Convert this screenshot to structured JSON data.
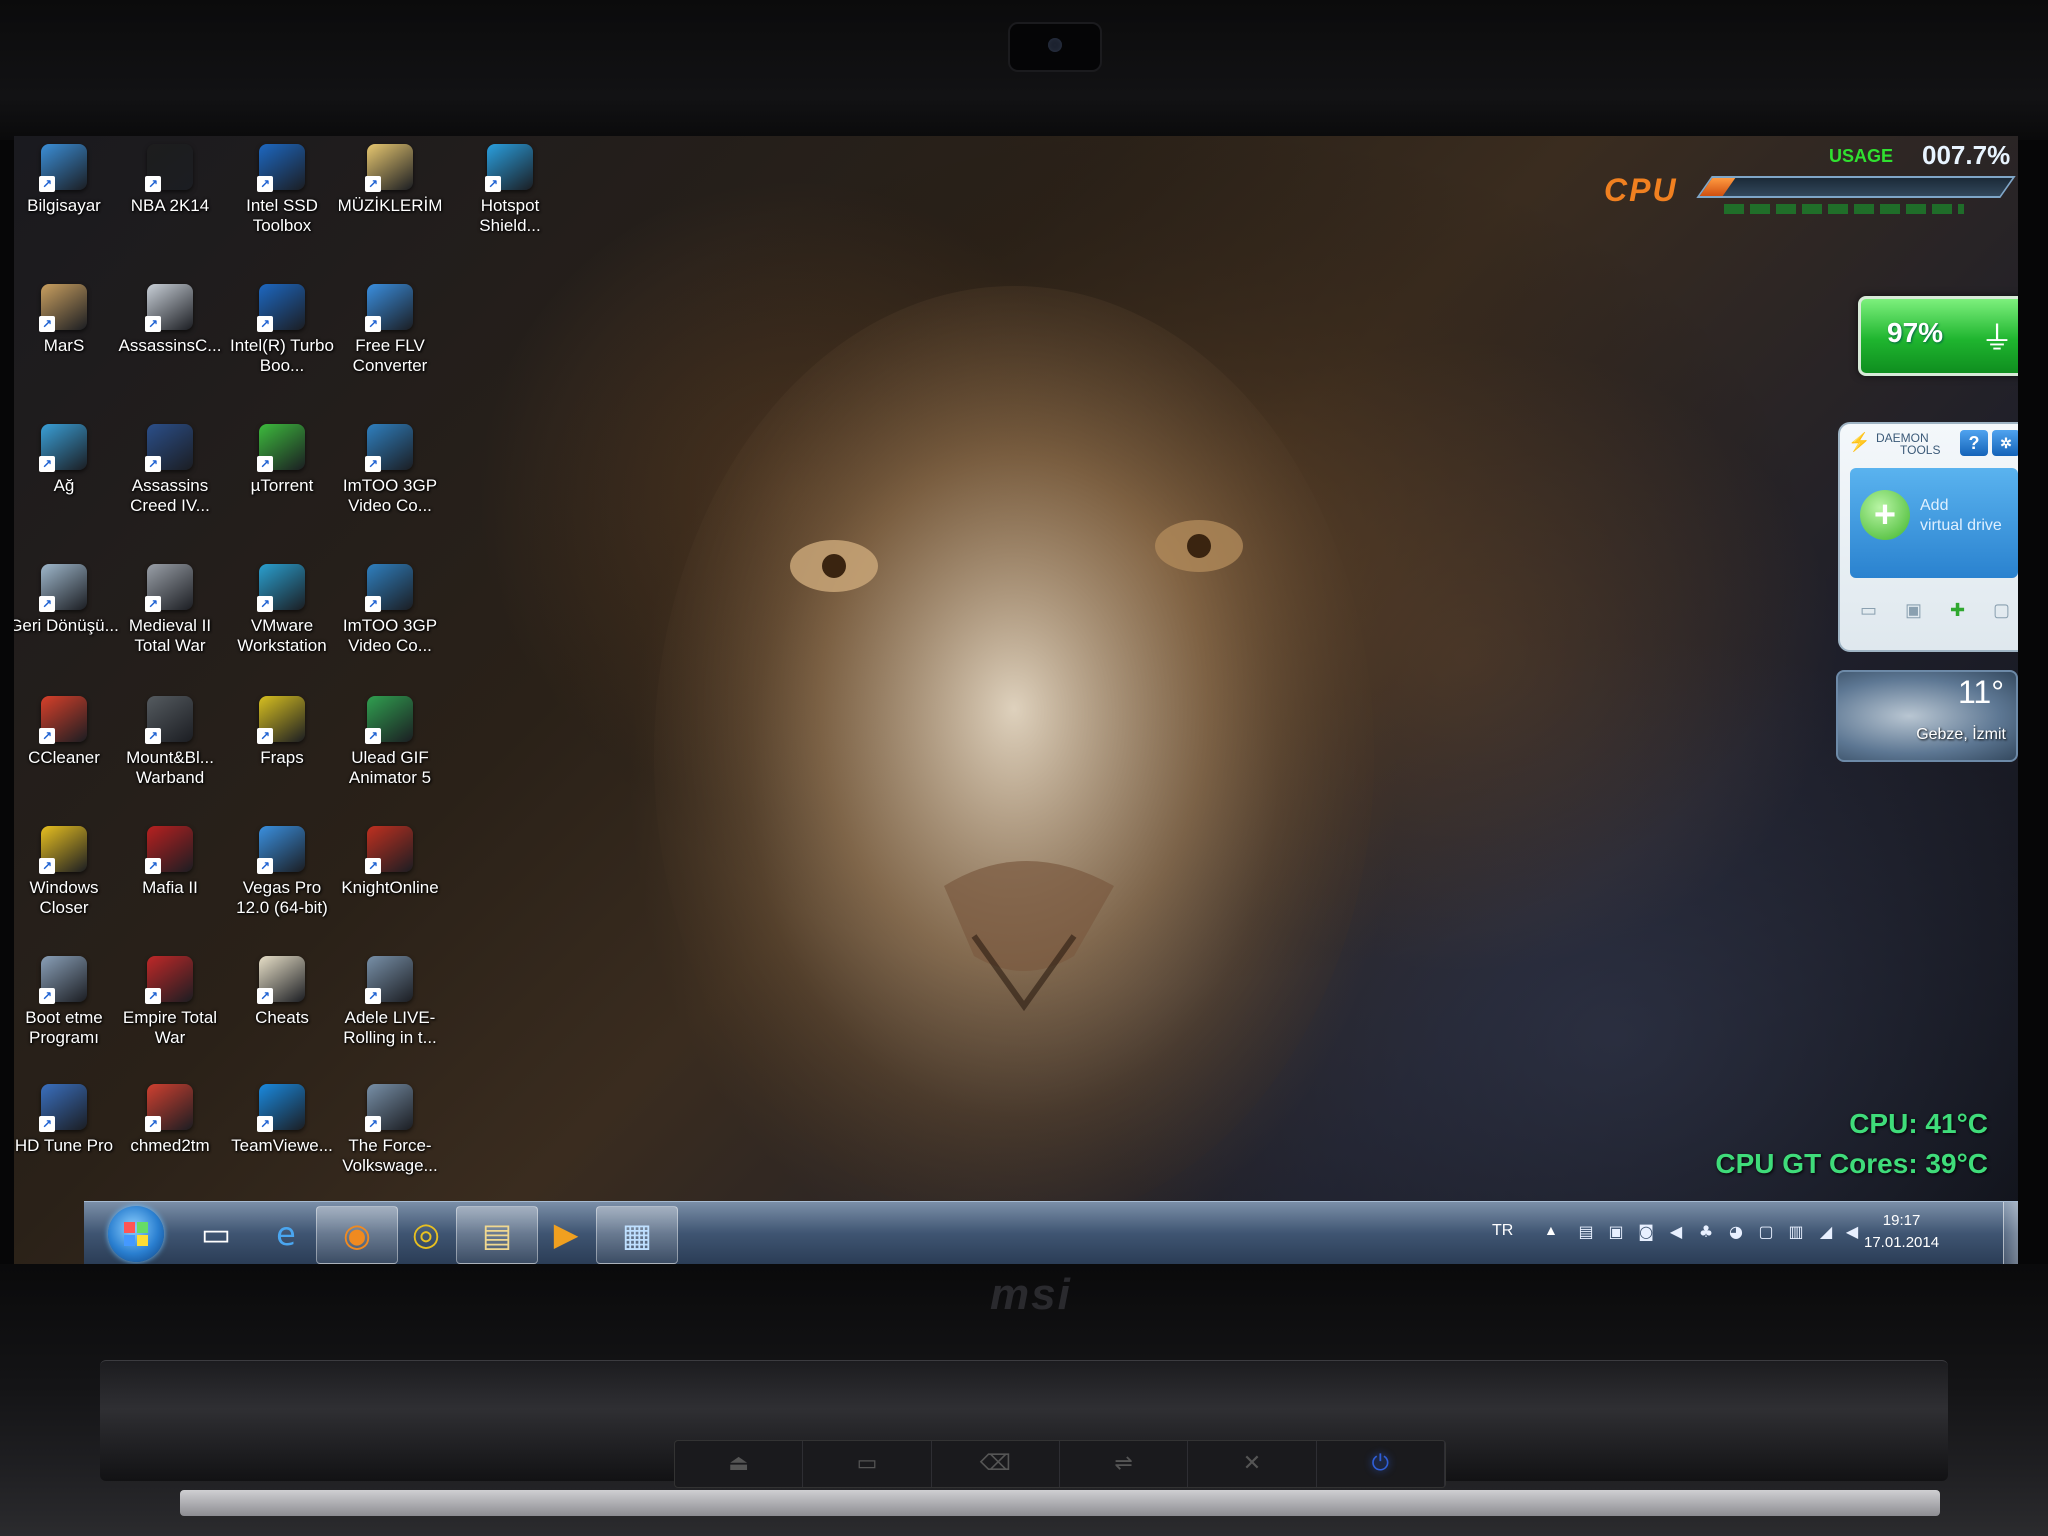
{
  "desktop_icons": [
    {
      "label": "Bilgisayar",
      "icon": "computer-icon",
      "color": "#3b8fd8"
    },
    {
      "label": "NBA 2K14",
      "icon": "nba-icon",
      "color": "#1d1d1d"
    },
    {
      "label": "Intel SSD Toolbox",
      "icon": "intel-icon",
      "color": "#1d68c2"
    },
    {
      "label": "MÜZİKLERİM",
      "icon": "folder-icon",
      "color": "#e8c870"
    },
    {
      "label": "Hotspot Shield...",
      "icon": "shield-icon",
      "color": "#2aa0e0"
    },
    {
      "label": "MarS",
      "icon": "folder-user-icon",
      "color": "#caa060"
    },
    {
      "label": "AssassinsC...",
      "icon": "assassins-icon",
      "color": "#c9d0d8"
    },
    {
      "label": "Intel(R) Turbo Boo...",
      "icon": "turbo-boost-icon",
      "color": "#1d68c2"
    },
    {
      "label": "Free FLV Converter",
      "icon": "converter-icon",
      "color": "#3a8fe0"
    },
    {
      "label": "Ağ",
      "icon": "network-icon",
      "color": "#3aa0d8"
    },
    {
      "label": "Assassins Creed IV...",
      "icon": "creed-icon",
      "color": "#2b4f8a"
    },
    {
      "label": "µTorrent",
      "icon": "utorrent-icon",
      "color": "#3dbb3d"
    },
    {
      "label": "ImTOO 3GP Video Co...",
      "icon": "imtoo-icon",
      "color": "#2f80c0"
    },
    {
      "label": "Geri Dönüşü...",
      "icon": "recycle-bin-icon",
      "color": "#9fb8cc"
    },
    {
      "label": "Medieval II Total War",
      "icon": "medieval-icon",
      "color": "#9aa0a8"
    },
    {
      "label": "VMware Workstation",
      "icon": "vmware-icon",
      "color": "#2aa0d0"
    },
    {
      "label": "ImTOO 3GP Video Co...",
      "icon": "imtoo-icon",
      "color": "#2f80c0"
    },
    {
      "label": "CCleaner",
      "icon": "ccleaner-icon",
      "color": "#d8402a"
    },
    {
      "label": "Mount&Bl... Warband",
      "icon": "warband-icon",
      "color": "#555b60"
    },
    {
      "label": "Fraps",
      "icon": "fraps-icon",
      "color": "#d8c020"
    },
    {
      "label": "Ulead GIF Animator 5",
      "icon": "ulead-icon",
      "color": "#30a050"
    },
    {
      "label": "Windows Closer",
      "icon": "moon-icon",
      "color": "#e8c020"
    },
    {
      "label": "Mafia II",
      "icon": "mafia-icon",
      "color": "#b82020"
    },
    {
      "label": "Vegas Pro 12.0 (64-bit)",
      "icon": "vegas-icon",
      "color": "#3a90e0"
    },
    {
      "label": "KnightOnline",
      "icon": "knight-online-icon",
      "color": "#c03020"
    },
    {
      "label": "Boot etme Programı",
      "icon": "boot-icon",
      "color": "#8aa0b8"
    },
    {
      "label": "Empire Total War",
      "icon": "empire-icon",
      "color": "#c02828"
    },
    {
      "label": "Cheats",
      "icon": "folder-icon",
      "color": "#e8e0c8"
    },
    {
      "label": "Adele LIVE-Rolling in t...",
      "icon": "video-file-icon",
      "color": "#7890a8"
    },
    {
      "label": "HD Tune Pro",
      "icon": "hdtune-icon",
      "color": "#3a70c0"
    },
    {
      "label": "chmed2tm",
      "icon": "chmed-icon",
      "color": "#d04030"
    },
    {
      "label": "TeamViewe...",
      "icon": "teamviewer-icon",
      "color": "#1a8ae0"
    },
    {
      "label": "The Force-Volkswage...",
      "icon": "video-file-icon",
      "color": "#7890a8"
    }
  ],
  "cpu_gadget": {
    "title": "CPU",
    "usage_label": "USAGE",
    "usage_value": "007.7%",
    "usage_fraction": 0.077
  },
  "battery_gadget": {
    "percent": "97%",
    "level": 0.97
  },
  "daemon_tools": {
    "brand_line1": "DAEMON",
    "brand_line2": "TOOLS",
    "help": "?",
    "add_line1": "Add",
    "add_line2": "virtual drive"
  },
  "weather": {
    "temp": "11°",
    "location": "Gebze, İzmit"
  },
  "temps": {
    "cpu": "CPU: 41°C",
    "gt": "CPU GT Cores: 39°C"
  },
  "taskbar": {
    "pinned": [
      {
        "icon": "explorer-window-icon"
      },
      {
        "icon": "internet-explorer-icon"
      },
      {
        "icon": "firefox-icon"
      },
      {
        "icon": "chrome-icon"
      },
      {
        "icon": "folder-icon"
      },
      {
        "icon": "media-player-icon"
      },
      {
        "icon": "remote-desktop-icon"
      }
    ],
    "language": "TR",
    "time": "19:17",
    "date": "17.01.2014"
  },
  "brand": "msi"
}
